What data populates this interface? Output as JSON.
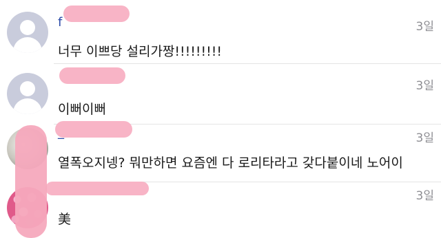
{
  "comments": [
    {
      "username": "f",
      "time": "3일",
      "text": "너무 이쁘당 설리가짱!!!!!!!!!",
      "avatar": "default-avatar"
    },
    {
      "username": "",
      "time": "3일",
      "text": "이뻐이뻐",
      "avatar": "default-avatar"
    },
    {
      "username": "_",
      "time": "3일",
      "text": "열폭오지넹? 뭐만하면 요즘엔 다 로리타라고 갖다붙이네 노어이",
      "avatar": "photo-avatar"
    },
    {
      "username": "",
      "time": "3일",
      "text": "美",
      "avatar": "floral-avatar"
    }
  ],
  "colors": {
    "username": "#2b4aa8",
    "time": "#8e8e93",
    "redaction": "#f8b4c6",
    "divider": "#e4e4e4"
  }
}
